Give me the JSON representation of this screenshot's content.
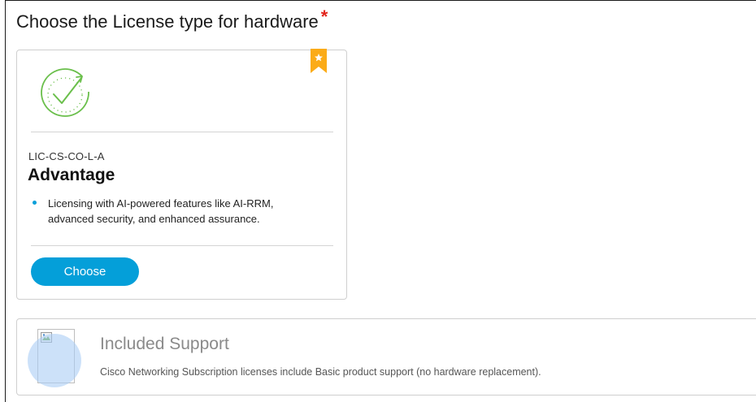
{
  "header": {
    "title": "Choose the License type for hardware",
    "required_marker": "*"
  },
  "license_card": {
    "sku": "LIC-CS-CO-L-A",
    "name": "Advantage",
    "features": [
      "Licensing with AI-powered features like AI-RRM, advanced security, and enhanced assurance."
    ],
    "button_label": "Choose",
    "badge_icon": "star-bookmark-icon",
    "status_icon": "check-circle-icon"
  },
  "support": {
    "title": "Included Support",
    "description": "Cisco Networking Subscription licenses include Basic product support (no hardware replacement).",
    "image_icon": "broken-image-icon"
  },
  "colors": {
    "accent": "#049fd9",
    "check_green": "#6abf4b",
    "bookmark_yellow": "#fbab18",
    "required_red": "#e2231a"
  }
}
